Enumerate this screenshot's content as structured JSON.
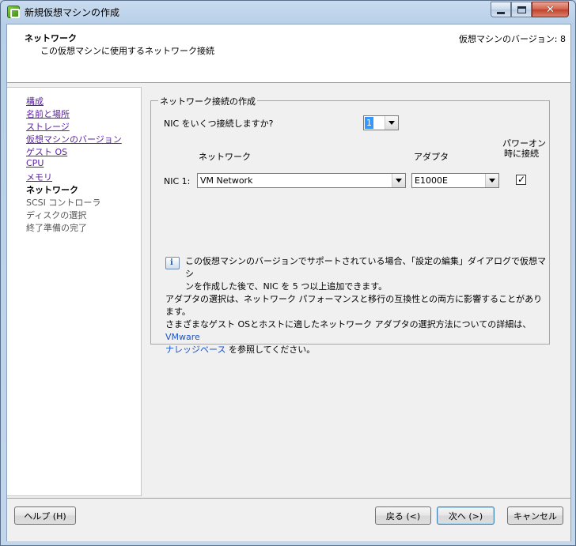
{
  "window": {
    "title": "新規仮想マシンの作成",
    "minimize_label": "",
    "maximize_label": "",
    "close_label": "✕"
  },
  "header": {
    "title": "ネットワーク",
    "subtitle": "この仮想マシンに使用するネットワーク接続",
    "version": "仮想マシンのバージョン: 8"
  },
  "sidebar": {
    "items": [
      {
        "label": "構成",
        "state": "link"
      },
      {
        "label": "名前と場所",
        "state": "link"
      },
      {
        "label": "ストレージ",
        "state": "link"
      },
      {
        "label": "仮想マシンのバージョン",
        "state": "link"
      },
      {
        "label": "ゲスト OS",
        "state": "link"
      },
      {
        "label": "CPU",
        "state": "link"
      },
      {
        "label": "メモリ",
        "state": "link"
      },
      {
        "label": "ネットワーク",
        "state": "current"
      },
      {
        "label": "SCSI コントローラ",
        "state": "future"
      },
      {
        "label": "ディスクの選択",
        "state": "future"
      },
      {
        "label": "終了準備の完了",
        "state": "future"
      }
    ]
  },
  "network": {
    "group_title": "ネットワーク接続の作成",
    "nic_count_question": "NIC をいくつ接続しますか?",
    "nic_count_value": "1",
    "col_network": "ネットワーク",
    "col_adapter": "アダプタ",
    "col_power_on_line1": "パワーオン",
    "col_power_on_line2": "時に接続",
    "nic1_label": "NIC 1:",
    "nic1_network": "VM Network",
    "nic1_adapter": "E1000E",
    "nic1_connect_checked": true,
    "checkmark": "✓",
    "info_icon_glyph": "i",
    "info_line1": "この仮想マシンのバージョンでサポートされている場合、「設定の編集」ダイアログで仮想マシ",
    "info_line2": "ンを作成した後で、NIC を 5 つ以上追加できます。",
    "adapter_line1": "アダプタの選択は、ネットワーク パフォーマンスと移行の互換性との両方に影響することがあります。",
    "adapter_line2": "さまざまなゲスト OSとホストに適したネットワーク アダプタの選択方法についての詳細は、",
    "adapter_link_part1": "VMware",
    "adapter_link_part2": "ナレッジベース",
    "adapter_line3_suffix": " を参照してください。"
  },
  "footer": {
    "help_label": "ヘルプ (H)",
    "back_label": "戻る (<)",
    "next_label": "次へ (>)",
    "cancel_label": "キャンセル"
  }
}
